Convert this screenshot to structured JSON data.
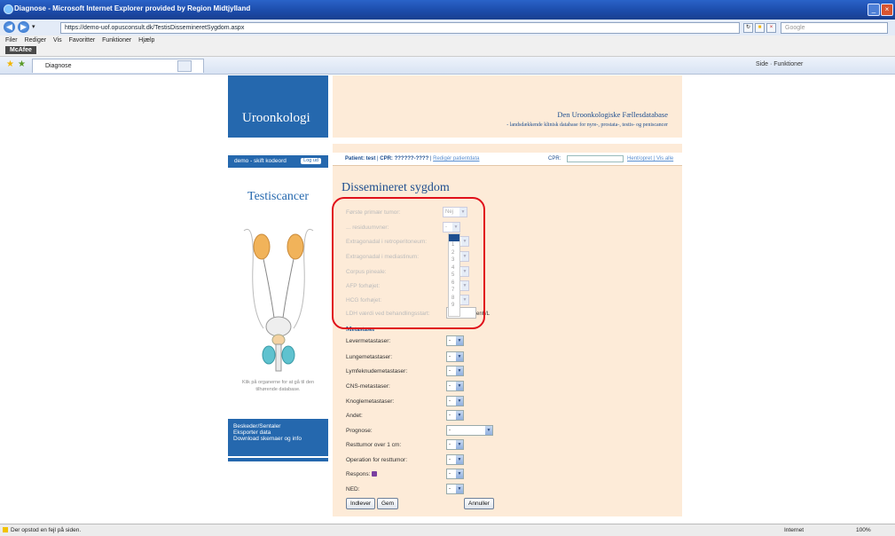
{
  "window": {
    "title": "Diagnose - Microsoft Internet Explorer provided by Region Midtjylland"
  },
  "address": {
    "url": "https://demo-uof.opusconsult.dk/TestisDissemineretSygdom.aspx",
    "search_placeholder": "Google"
  },
  "menu": {
    "items": [
      "Filer",
      "Rediger",
      "Vis",
      "Favoritter",
      "Funktioner",
      "Hjælp"
    ]
  },
  "toolbar": {
    "mcafee": "McAfee"
  },
  "tab": {
    "label": "Diagnose"
  },
  "commandbar": {
    "text": "Side  ·  Funktioner"
  },
  "header": {
    "logo": "Uroonkologi",
    "db_title": "Den Uroonkologiske Fællesdatabase",
    "db_subtitle": "- landsdækkende klinisk database for nyre-, prostata-, testis- og peniscancer"
  },
  "user": {
    "name": "demo - skift kodeord",
    "logout": "Log ud"
  },
  "sidebar": {
    "title": "Testiscancer",
    "hint": "Klik på organerne for at gå til den tilhørende database.",
    "links": [
      "Beskeder/Sentaler",
      "Eksporter data",
      "Download skemaer og info"
    ]
  },
  "patient": {
    "label": "Patient: test",
    "cpr": "CPR: ??????-????",
    "edit_link": "Redigér patientdata",
    "cpr_label": "CPR:",
    "fetch_link": "Hent/opret",
    "view_all": "Vis alle"
  },
  "form": {
    "title": "Dissemineret sygdom",
    "dim_fields": [
      {
        "label": "Første primær tumor:",
        "value": "Nej"
      },
      {
        "label": "... residuumvner:",
        "value": "-"
      },
      {
        "label": "Extragonadal i retroperitoneum:",
        "value": "-"
      },
      {
        "label": "Extragonadal i mediastinum:",
        "value": "-"
      },
      {
        "label": "Corpus pineale:",
        "value": "-"
      },
      {
        "label": "AFP forhøjet:",
        "value": "-"
      },
      {
        "label": "HCG forhøjet:",
        "value": "-"
      },
      {
        "label": "LDH værdi ved behandlingsstart:",
        "value": ""
      }
    ],
    "dropdown_options": [
      "1",
      "2",
      "3",
      "4",
      "5",
      "6",
      "7",
      "8",
      "9"
    ],
    "ldh_unit": "enh/L",
    "meta_heading": "Metastaser",
    "fields": [
      {
        "label": "Levermetastaser:",
        "value": "-"
      },
      {
        "label": "Lungemetastaser:",
        "value": "-"
      },
      {
        "label": "Lymfeknudemetastaser:",
        "value": "-"
      },
      {
        "label": "CNS-metastaser:",
        "value": "-"
      },
      {
        "label": "Knoglemetastaser:",
        "value": "-"
      },
      {
        "label": "Andet:",
        "value": "-"
      },
      {
        "label": "Prognose:",
        "value": "-"
      },
      {
        "label": "Resttumor over 1 cm:",
        "value": "-"
      },
      {
        "label": "Operation for resttumor:",
        "value": "-"
      },
      {
        "label": "Respons:",
        "value": "-"
      },
      {
        "label": "NED:",
        "value": "-"
      }
    ],
    "buttons": {
      "submit": "Indlever",
      "save": "Gem",
      "cancel": "Annuller"
    }
  },
  "status": {
    "message": "Der opstod en fejl på siden.",
    "zone": "Internet",
    "zoom": "100%"
  }
}
